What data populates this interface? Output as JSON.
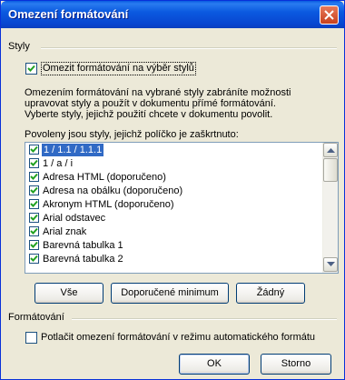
{
  "window": {
    "title": "Omezení formátování"
  },
  "styles_section": {
    "label": "Styly",
    "limit_checkbox": {
      "label": "Omezit formátování na výběr stylů",
      "checked": true
    },
    "description_lines": [
      "Omezením formátování na vybrané styly zabráníte možnosti",
      "upravovat styly a použít v dokumentu přímé formátování.",
      "Vyberte styly, jejichž použití chcete v dokumentu povolit."
    ],
    "allowed_label": "Povoleny jsou styly, jejichž políčko je zaškrtnuto:",
    "styles": [
      {
        "label": "1 / 1.1 / 1.1.1",
        "checked": true,
        "selected": true
      },
      {
        "label": "1 / a / i",
        "checked": true
      },
      {
        "label": "Adresa HTML (doporučeno)",
        "checked": true
      },
      {
        "label": "Adresa na obálku (doporučeno)",
        "checked": true
      },
      {
        "label": "Akronym HTML (doporučeno)",
        "checked": true
      },
      {
        "label": "Arial odstavec",
        "checked": true
      },
      {
        "label": "Arial znak",
        "checked": true
      },
      {
        "label": "Barevná tabulka 1",
        "checked": true
      },
      {
        "label": "Barevná tabulka 2",
        "checked": true
      }
    ],
    "buttons": {
      "all": "Vše",
      "recommended": "Doporučené minimum",
      "none": "Žádný"
    }
  },
  "formatting_section": {
    "label": "Formátování",
    "suppress_checkbox": {
      "label": "Potlačit omezení formátování v režimu automatického formátu",
      "checked": false
    }
  },
  "footer": {
    "ok": "OK",
    "cancel": "Storno"
  },
  "colors": {
    "title_bar": "#0a5ce0",
    "selection": "#316ac5",
    "dialog_bg": "#ece9d8"
  },
  "icons": {
    "close": "close-icon",
    "check": "check-icon",
    "scroll_up": "scroll-up-arrow-icon",
    "scroll_down": "scroll-down-arrow-icon"
  }
}
